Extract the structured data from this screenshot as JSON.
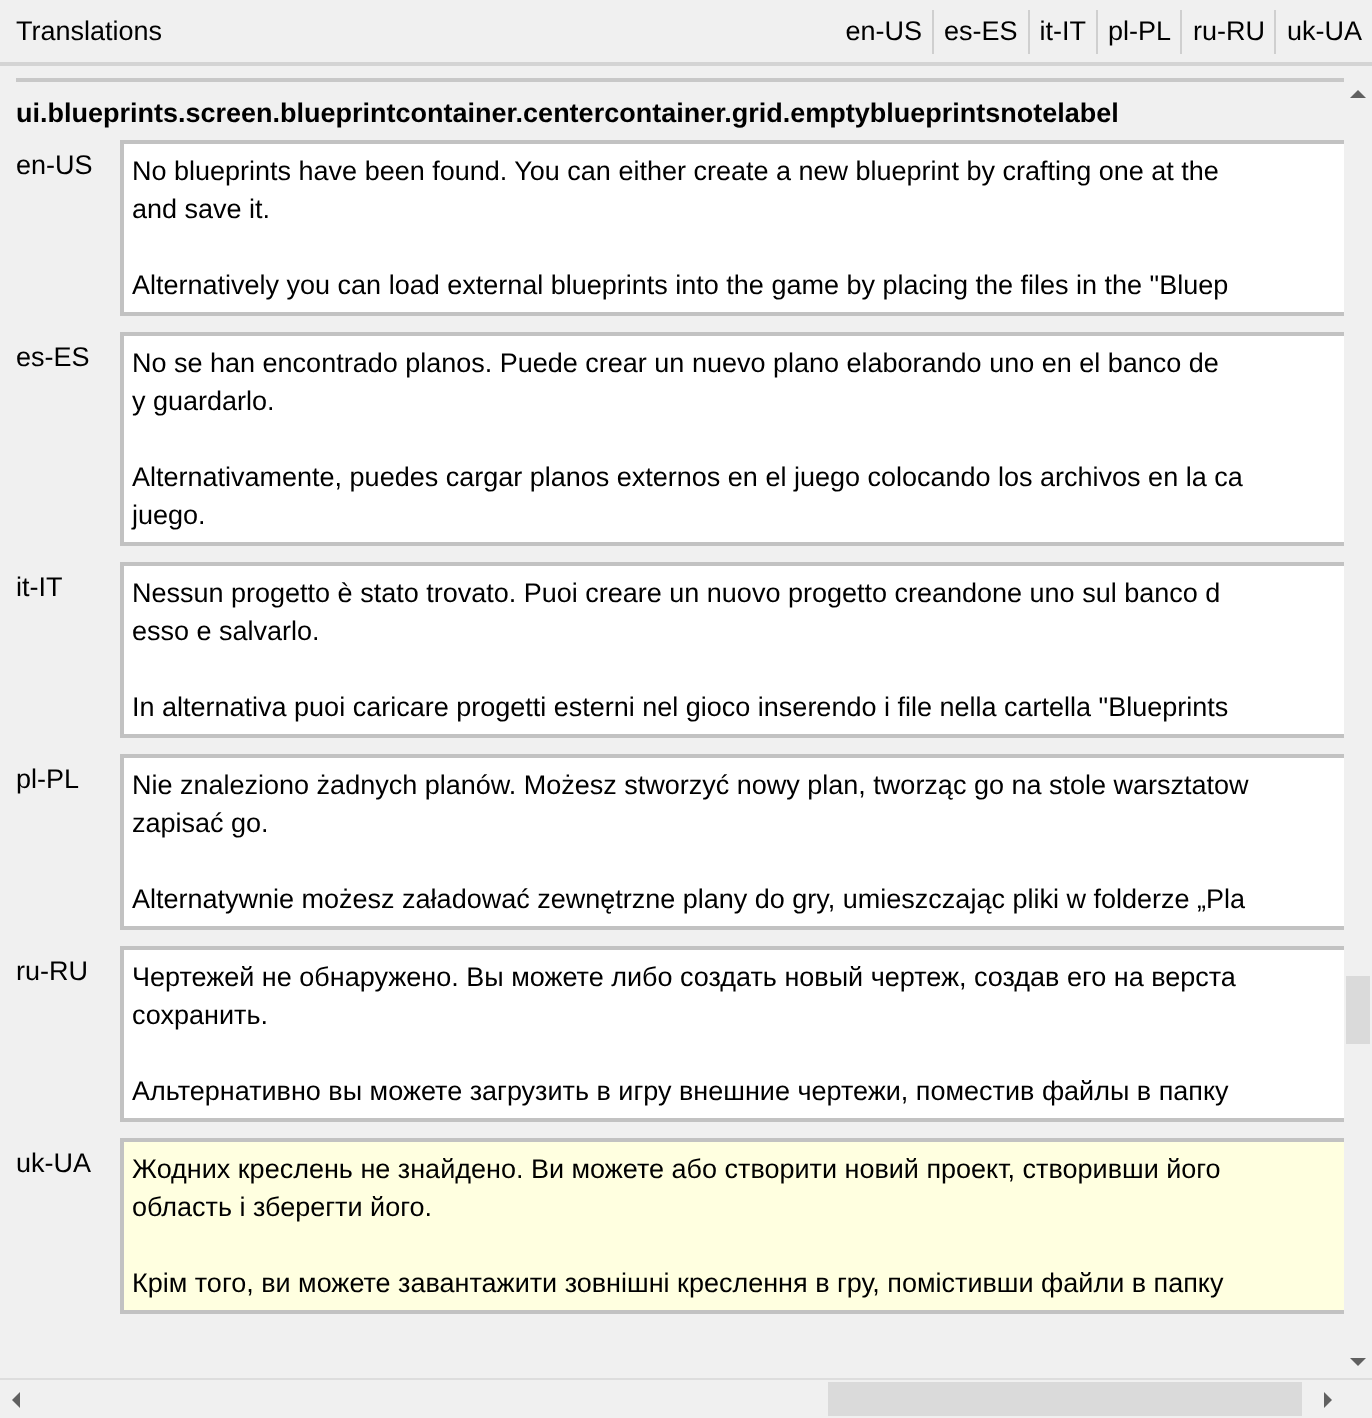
{
  "header": {
    "title": "Translations",
    "languages": [
      "en-US",
      "es-ES",
      "it-IT",
      "pl-PL",
      "ru-RU",
      "uk-UA"
    ]
  },
  "key": "ui.blueprints.screen.blueprintcontainer.centercontainer.grid.emptyblueprintsnotelabel",
  "translations": [
    {
      "language": "en-US",
      "highlighted": false,
      "paragraphs": [
        [
          "No blueprints have been found. You can either create a new blueprint by crafting one at the",
          "and save it."
        ],
        [
          "Alternatively you can load external blueprints into the game by placing the files in the \"Bluep"
        ]
      ]
    },
    {
      "language": "es-ES",
      "highlighted": false,
      "paragraphs": [
        [
          "No se han encontrado planos. Puede crear un nuevo plano elaborando uno en el banco de",
          "y guardarlo."
        ],
        [
          "Alternativamente, puedes cargar planos externos en el juego colocando los archivos en la ca",
          "juego."
        ]
      ]
    },
    {
      "language": "it-IT",
      "highlighted": false,
      "paragraphs": [
        [
          "Nessun progetto è stato trovato. Puoi creare un nuovo progetto creandone uno sul banco d",
          "esso e salvarlo."
        ],
        [
          "In alternativa puoi caricare progetti esterni nel gioco inserendo i file nella cartella \"Blueprints"
        ]
      ]
    },
    {
      "language": "pl-PL",
      "highlighted": false,
      "paragraphs": [
        [
          "Nie znaleziono żadnych planów. Możesz stworzyć nowy plan, tworząc go na stole warsztatow",
          "zapisać go."
        ],
        [
          "Alternatywnie możesz załadować zewnętrzne plany do gry, umieszczając pliki w folderze „Pla"
        ]
      ]
    },
    {
      "language": "ru-RU",
      "highlighted": false,
      "paragraphs": [
        [
          "Чертежей не обнаружено. Вы можете либо создать новый чертеж, создав его на верста",
          "сохранить."
        ],
        [
          "Альтернативно вы можете загрузить в игру внешние чертежи, поместив файлы в папку"
        ]
      ]
    },
    {
      "language": "uk-UA",
      "highlighted": true,
      "paragraphs": [
        [
          "Жодних креслень не знайдено. Ви можете або створити новий проект, створивши його",
          "область і зберегти його."
        ],
        [
          "Крім того, ви можете завантажити зовнішні креслення в гру, помістивши файли в папку"
        ]
      ]
    }
  ]
}
